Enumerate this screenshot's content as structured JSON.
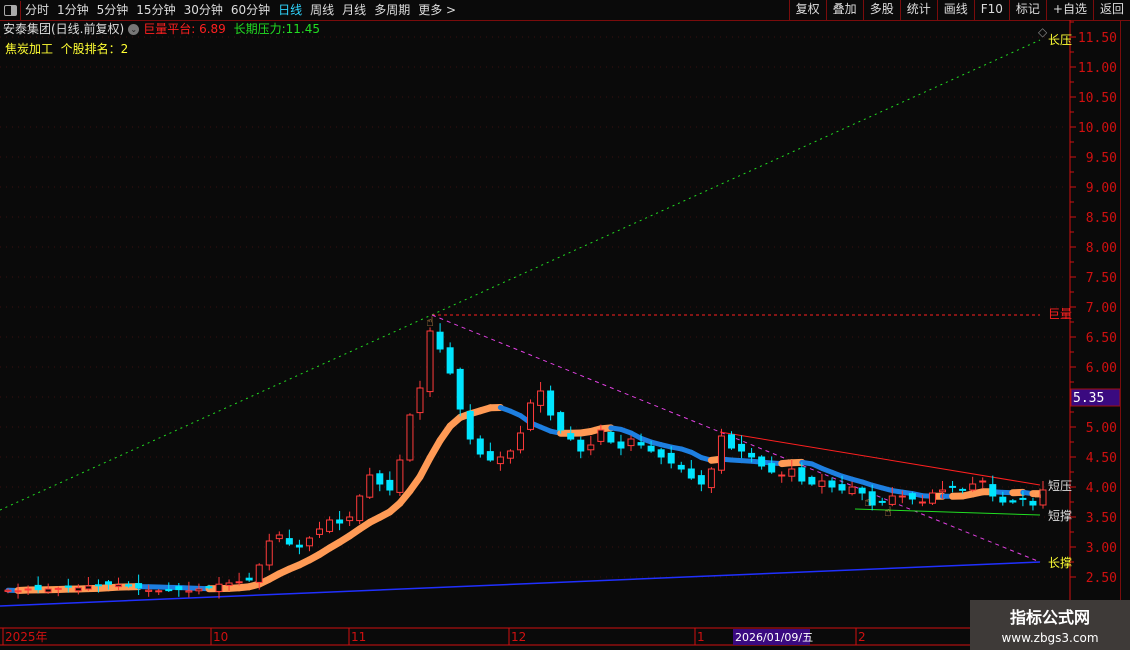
{
  "toolbar": {
    "periods": [
      "分时",
      "1分钟",
      "5分钟",
      "15分钟",
      "30分钟",
      "60分钟",
      "日线",
      "周线",
      "月线",
      "多周期",
      "更多 >"
    ],
    "active": "日线",
    "buttons": [
      "复权",
      "叠加",
      "多股",
      "统计",
      "画线",
      "F10",
      "标记",
      "+自选",
      "返回"
    ]
  },
  "info": {
    "title": "安泰集团(日线.前复权)",
    "platform_label": "巨量平台:",
    "platform_value": "6.89",
    "pressure_label": "长期压力:",
    "pressure_value": "11.45",
    "sector": "焦炭加工",
    "rank_label": "个股排名：",
    "rank_value": "2"
  },
  "labels": {
    "long_pressure": "长压",
    "volume_platform": "巨量",
    "short_pressure": "短压",
    "short_support": "短撑",
    "long_support": "长撑"
  },
  "price_axis": {
    "ticks": [
      "2.50",
      "3.00",
      "3.50",
      "4.00",
      "4.50",
      "5.00",
      "5.50",
      "6.00",
      "6.50",
      "7.00",
      "7.50",
      "8.00",
      "8.50",
      "9.00",
      "9.50",
      "10.00",
      "10.50",
      "11.00",
      "11.50"
    ],
    "current": "5.35"
  },
  "time_axis": [
    "2025年",
    "10",
    "11",
    "12",
    "1",
    "2",
    "2026/01/09/五"
  ],
  "colors": {
    "up": "#ff3b3b",
    "down": "#00e5ff",
    "ma_up": "#ff9a55",
    "ma_down": "#1e7fe0",
    "axis": "#d01010",
    "cursor_bg": "#3a0a80"
  },
  "chart_data": {
    "type": "candlestick",
    "closes": [
      2.28,
      2.27,
      2.3,
      2.29,
      2.3,
      2.31,
      2.33,
      2.32,
      2.35,
      2.36,
      2.38,
      2.37,
      2.35,
      2.32,
      2.28,
      2.27,
      2.28,
      2.29,
      2.27,
      2.3,
      2.32,
      2.38,
      2.4,
      2.42,
      2.45,
      2.7,
      3.1,
      3.2,
      3.05,
      3.0,
      3.15,
      3.3,
      3.45,
      3.4,
      3.5,
      3.85,
      4.2,
      4.05,
      3.95,
      4.45,
      5.2,
      5.65,
      6.6,
      6.3,
      5.9,
      5.3,
      4.8,
      4.55,
      4.45,
      4.5,
      4.6,
      4.9,
      5.4,
      5.6,
      5.2,
      4.95,
      4.8,
      4.6,
      4.7,
      4.95,
      4.75,
      4.65,
      4.8,
      4.7,
      4.6,
      4.5,
      4.4,
      4.3,
      4.15,
      4.05,
      4.3,
      4.85,
      4.65,
      4.6,
      4.5,
      4.35,
      4.25,
      4.2,
      4.3,
      4.1,
      4.05,
      4.1,
      4.0,
      3.95,
      4.0,
      3.9,
      3.7,
      3.75,
      3.85,
      3.85,
      3.8,
      3.75,
      3.9,
      3.95,
      4.0,
      3.95,
      4.05,
      4.1,
      3.85,
      3.75,
      3.75,
      3.8,
      3.7,
      3.95
    ],
    "ylim": [
      1.7,
      11.7
    ]
  },
  "watermark": {
    "name": "指标公式网",
    "url": "www.zbgs3.com"
  }
}
